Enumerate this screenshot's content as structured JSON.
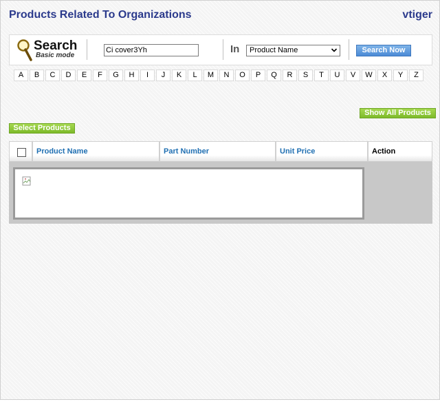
{
  "header": {
    "title": "Products Related To Organizations",
    "brand": "vtiger"
  },
  "search": {
    "word": "Search",
    "mode": "Basic mode",
    "input_value": "Ci cover3Yh",
    "in_label": "In",
    "field_selected": "Product Name",
    "button_label": "Search Now"
  },
  "alphabet": [
    "A",
    "B",
    "C",
    "D",
    "E",
    "F",
    "G",
    "H",
    "I",
    "J",
    "K",
    "L",
    "M",
    "N",
    "O",
    "P",
    "Q",
    "R",
    "S",
    "T",
    "U",
    "V",
    "W",
    "X",
    "Y",
    "Z"
  ],
  "actions": {
    "show_all": "Show All Products",
    "select": "Select Products"
  },
  "table": {
    "columns": [
      "Product Name",
      "Part Number",
      "Unit Price",
      "Action"
    ]
  },
  "colors": {
    "title": "#2b3a8c",
    "link": "#1f6fb2",
    "green": "#8cc63f",
    "blue_button": "#4b8ad6"
  }
}
